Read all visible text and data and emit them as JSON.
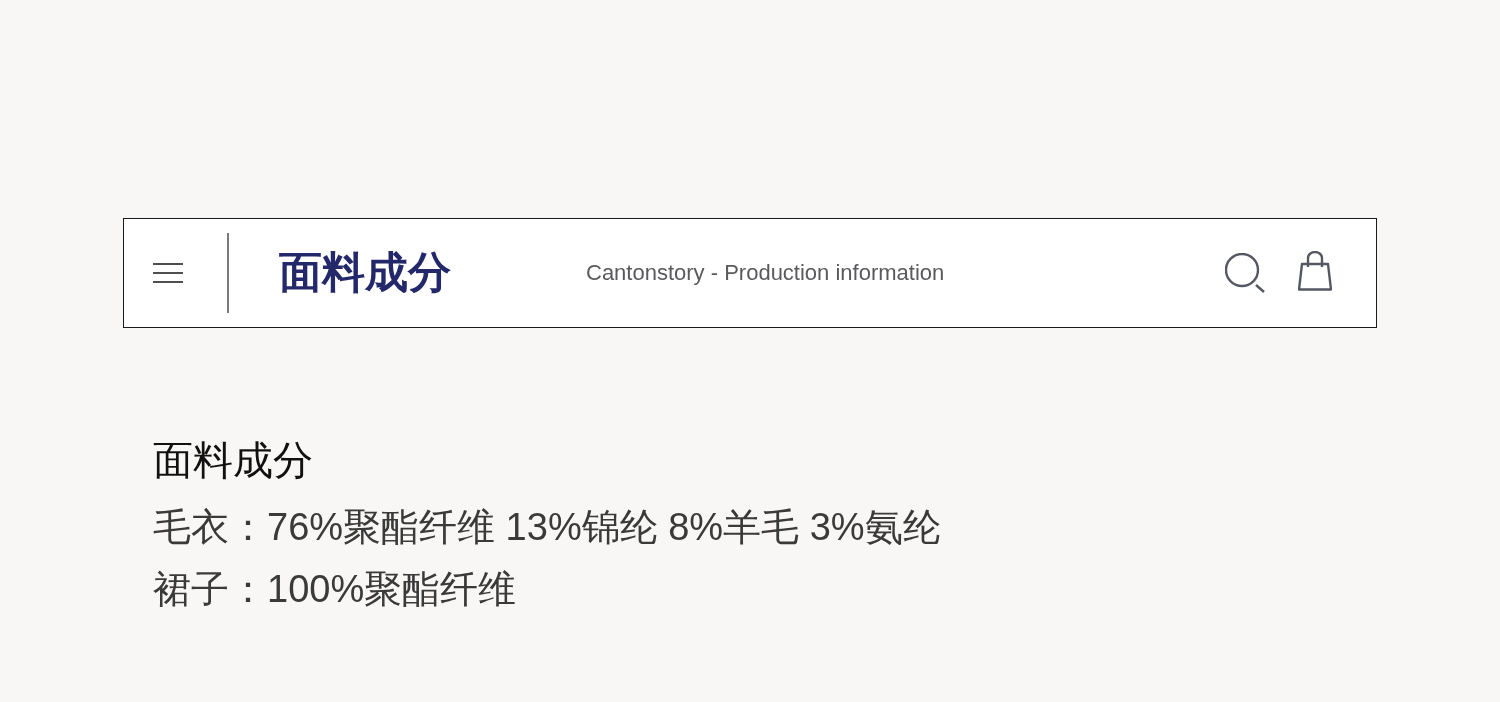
{
  "header": {
    "title": "面料成分",
    "tagline": "Cantonstory - Production information"
  },
  "composition": {
    "heading": "面料成分",
    "lines": [
      "毛衣：76%聚酯纤维 13%锦纶 8%羊毛 3%氨纶",
      "裙子：100%聚酯纤维"
    ]
  }
}
